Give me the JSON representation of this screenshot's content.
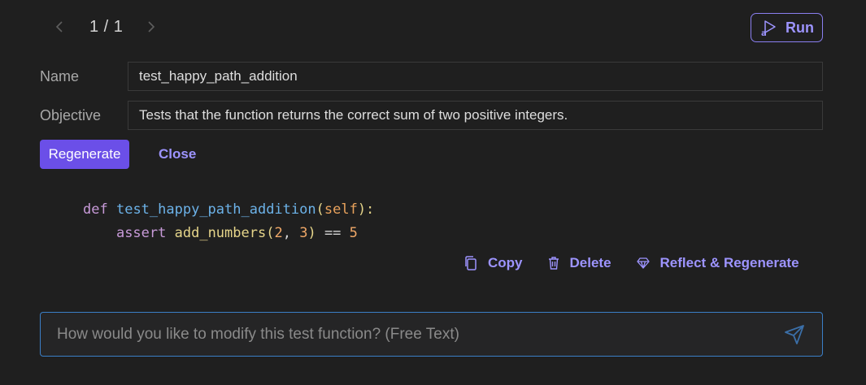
{
  "pager": {
    "text": "1 / 1"
  },
  "run_button": {
    "label": "Run",
    "icon": "play-icon"
  },
  "form": {
    "name_label": "Name",
    "name_value": "test_happy_path_addition",
    "objective_label": "Objective",
    "objective_value": "Tests that the function returns the correct sum of two positive integers."
  },
  "buttons": {
    "regenerate": "Regenerate",
    "close": "Close"
  },
  "code": {
    "line1": {
      "kw": "def",
      "fn": "test_happy_path_addition",
      "open": "(",
      "self": "self",
      "close": "):"
    },
    "line2": {
      "assert": "assert",
      "call": "add_numbers",
      "open": "(",
      "a": "2",
      "sep": ", ",
      "b": "3",
      "close": ")",
      "op": " == ",
      "result": "5"
    }
  },
  "actions": {
    "copy": "Copy",
    "delete": "Delete",
    "reflect": "Reflect & Regenerate"
  },
  "prompt": {
    "placeholder": "How would you like to modify this test function? (Free Text)"
  },
  "colors": {
    "accent": "#9d94ff",
    "primary_button": "#6b4fe8",
    "input_focus_border": "#3b7fc7",
    "background": "#1f1f1f"
  }
}
